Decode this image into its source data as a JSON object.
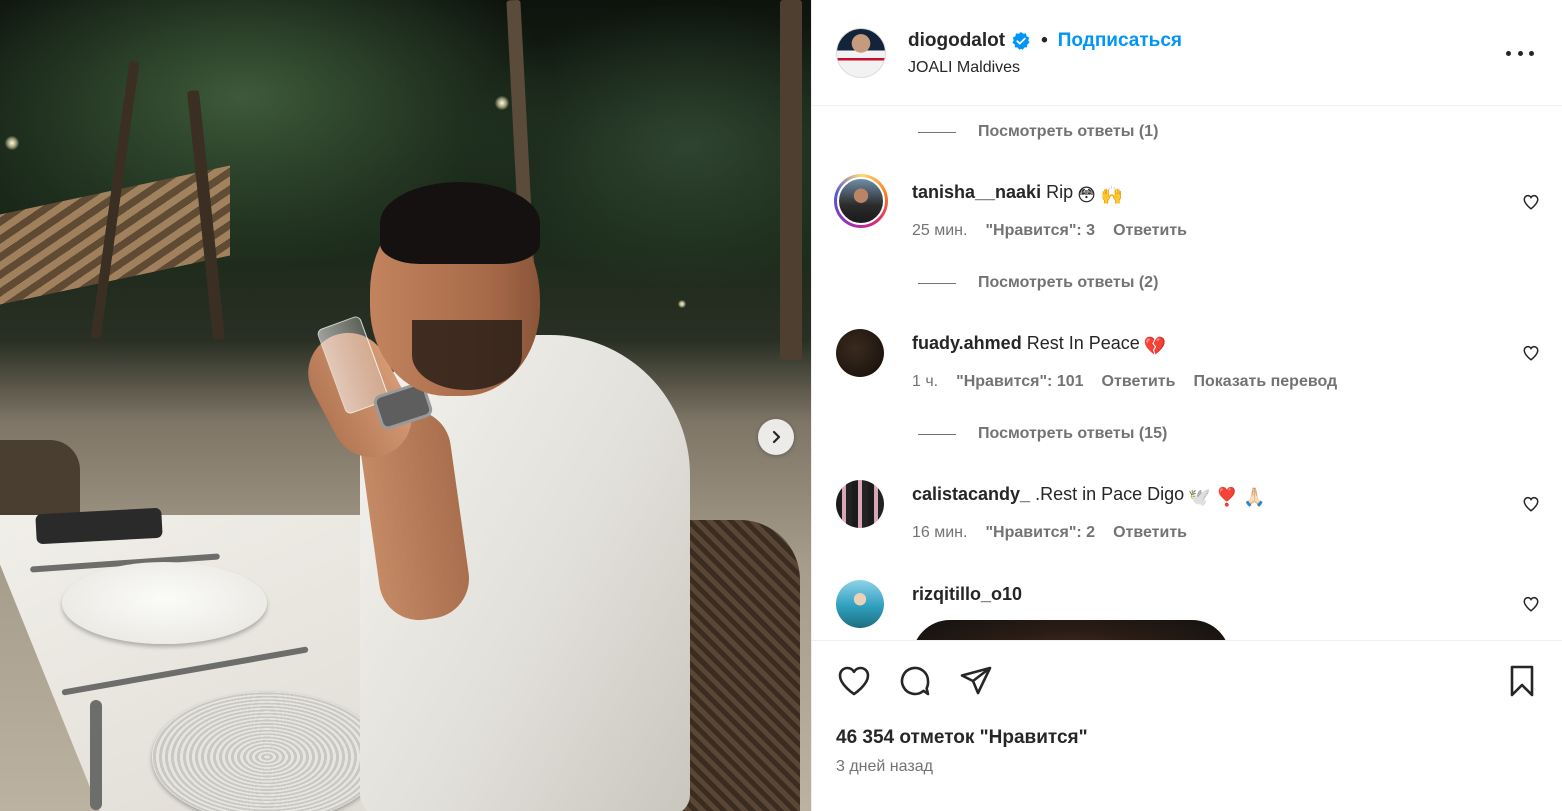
{
  "post": {
    "username": "diogodalot",
    "follow_label": "Подписаться",
    "separator": "•",
    "location": "JOALI Maldives",
    "likes_text": "46 354 отметок \"Нравится\"",
    "time_ago": "3 дней назад"
  },
  "comments": {
    "view_replies": [
      "Посмотреть ответы (1)",
      "Посмотреть ответы (2)",
      "Посмотреть ответы (15)"
    ],
    "items": [
      {
        "username": "tanisha__naaki",
        "text": "Rip",
        "emoji": "😳 🙌",
        "time": "25 мин.",
        "likes": "\"Нравится\": 3",
        "reply": "Ответить"
      },
      {
        "username": "fuady.ahmed",
        "text": "Rest In Peace",
        "emoji": "💔",
        "time": "1 ч.",
        "likes": "\"Нравится\": 101",
        "reply": "Ответить",
        "translate": "Показать перевод"
      },
      {
        "username": "calistacandy_",
        "text": ".Rest in Pace Digo",
        "emoji": "🕊️ ❣️ 🙏🏻",
        "time": "16 мин.",
        "likes": "\"Нравится\": 2",
        "reply": "Ответить"
      },
      {
        "username": "rizqitillo_o10"
      }
    ]
  },
  "icons": {
    "verified": "verified-badge-icon",
    "more": "more-horizontal-icon",
    "heart": "heart-outline-icon",
    "comment": "comment-bubble-icon",
    "share": "paper-plane-icon",
    "save": "bookmark-icon",
    "next": "chevron-right-icon"
  },
  "colors": {
    "accent": "#0095f6",
    "text": "#262626",
    "muted": "#737373"
  }
}
